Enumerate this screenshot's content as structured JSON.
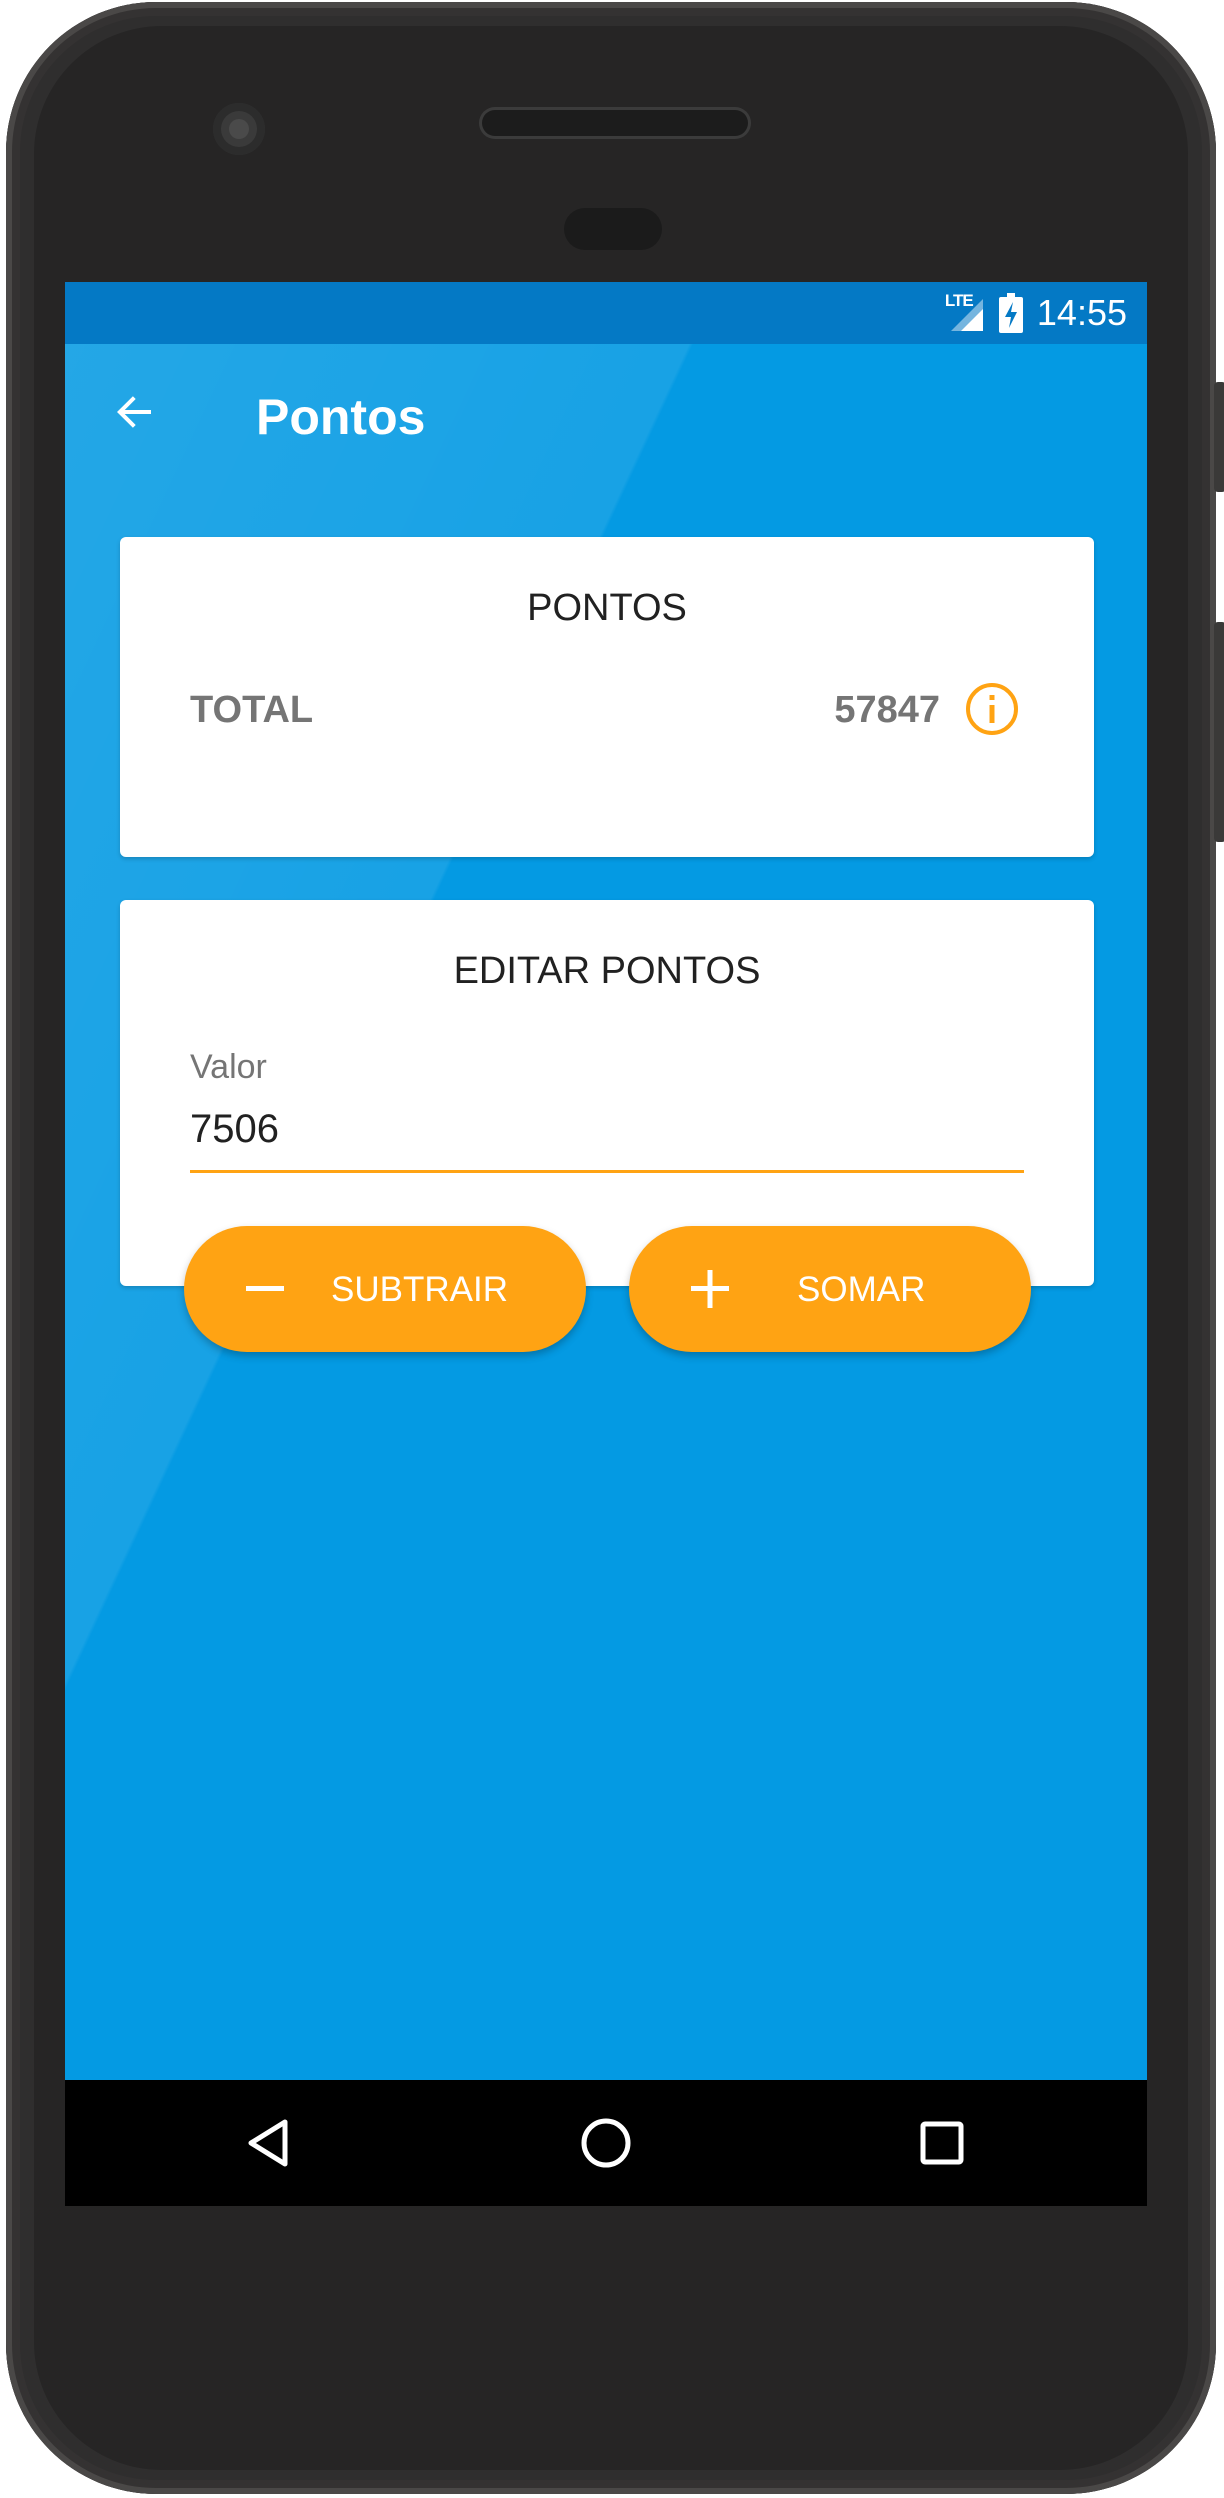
{
  "status_bar": {
    "time": "14:55",
    "network_label": "LTE",
    "icons": [
      "signal-icon",
      "battery-charging-icon"
    ]
  },
  "app_bar": {
    "title": "Pontos",
    "back_icon": "arrow-left-icon"
  },
  "points_card": {
    "title": "PONTOS",
    "total_label": "TOTAL",
    "total_value": "57847",
    "info_icon": "info-icon"
  },
  "edit_card": {
    "title": "EDITAR PONTOS",
    "field_label": "Valor",
    "field_value": "7506"
  },
  "buttons": {
    "subtract_label": "SUBTRAIR",
    "subtract_icon": "minus-icon",
    "add_label": "SOMAR",
    "add_icon": "plus-icon"
  },
  "nav_bar": {
    "icons": [
      "back-triangle-icon",
      "home-circle-icon",
      "recents-square-icon"
    ]
  },
  "colors": {
    "primary": "#049ae3",
    "primary_dark": "#0479c5",
    "accent": "#ffa313",
    "text_secondary": "#757575"
  }
}
